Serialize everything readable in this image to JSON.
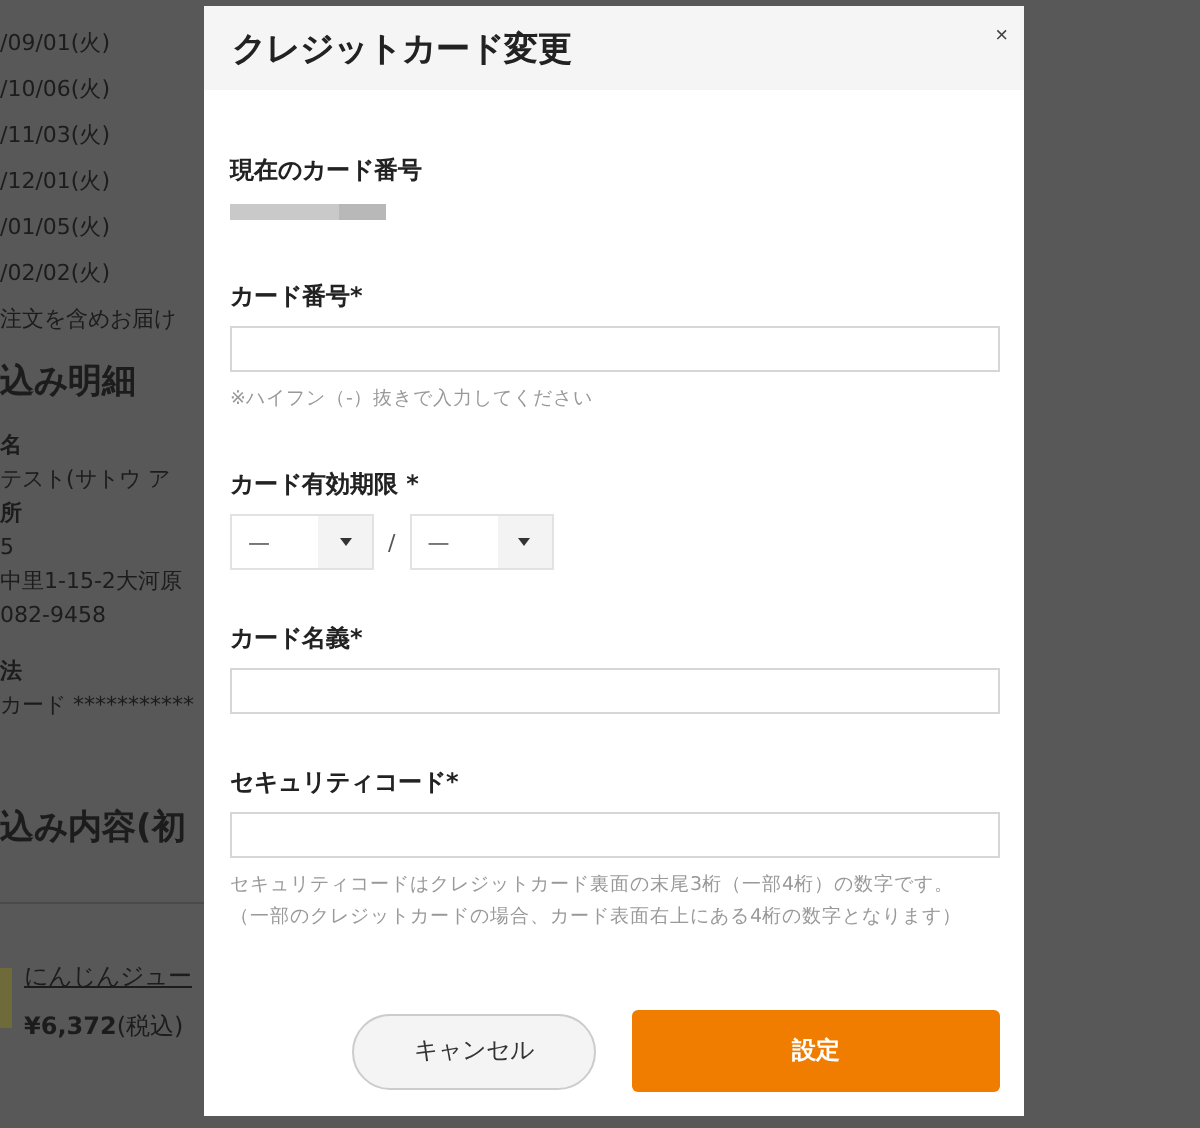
{
  "background_page": {
    "dates": [
      "/09/01(火)",
      "/10/06(火)",
      "/11/03(火)",
      "/12/01(火)",
      "/01/05(火)",
      "/02/02(火)"
    ],
    "delivery_note": "注文を含めお届け",
    "details_heading": "込み明細",
    "details": [
      {
        "kind": "label",
        "text": "名"
      },
      {
        "kind": "value",
        "text": "テスト(サトウ ア"
      },
      {
        "kind": "label",
        "text": "所"
      },
      {
        "kind": "value",
        "text": "5"
      },
      {
        "kind": "value",
        "text": "中里1-15-2大河原"
      },
      {
        "kind": "value",
        "text": "082-9458"
      },
      {
        "kind": "gap"
      },
      {
        "kind": "label",
        "text": "法"
      },
      {
        "kind": "value",
        "text": "カード ***********"
      }
    ],
    "contents_heading": "込み内容(初",
    "product": {
      "name": "にんじんジュー",
      "price": "**¥6,372**(税込)"
    }
  },
  "dialog": {
    "title": "クレジットカード変更",
    "close": "×",
    "current_card": {
      "label": "現在のカード番号"
    },
    "fields": [
      {
        "kind": "text",
        "label": "カード番号*",
        "hints": [
          "※ハイフン（-）抜きで入力してください"
        ]
      },
      {
        "kind": "expiry",
        "label": "カード有効期限 *",
        "month": "—",
        "separator": "/",
        "year": "—"
      },
      {
        "kind": "text",
        "label": "カード名義*"
      },
      {
        "kind": "text",
        "label": "セキュリティコード*",
        "hints": [
          "セキュリティコードはクレジットカード裏面の末尾3桁（一部4桁）の数字です。",
          "（一部のクレジットカードの場合、カード表面右上にある4桁の数字となります）"
        ]
      }
    ],
    "buttons": [
      {
        "kind": "cancel",
        "label": "キャンセル"
      },
      {
        "kind": "primary",
        "label": "設定"
      }
    ]
  }
}
